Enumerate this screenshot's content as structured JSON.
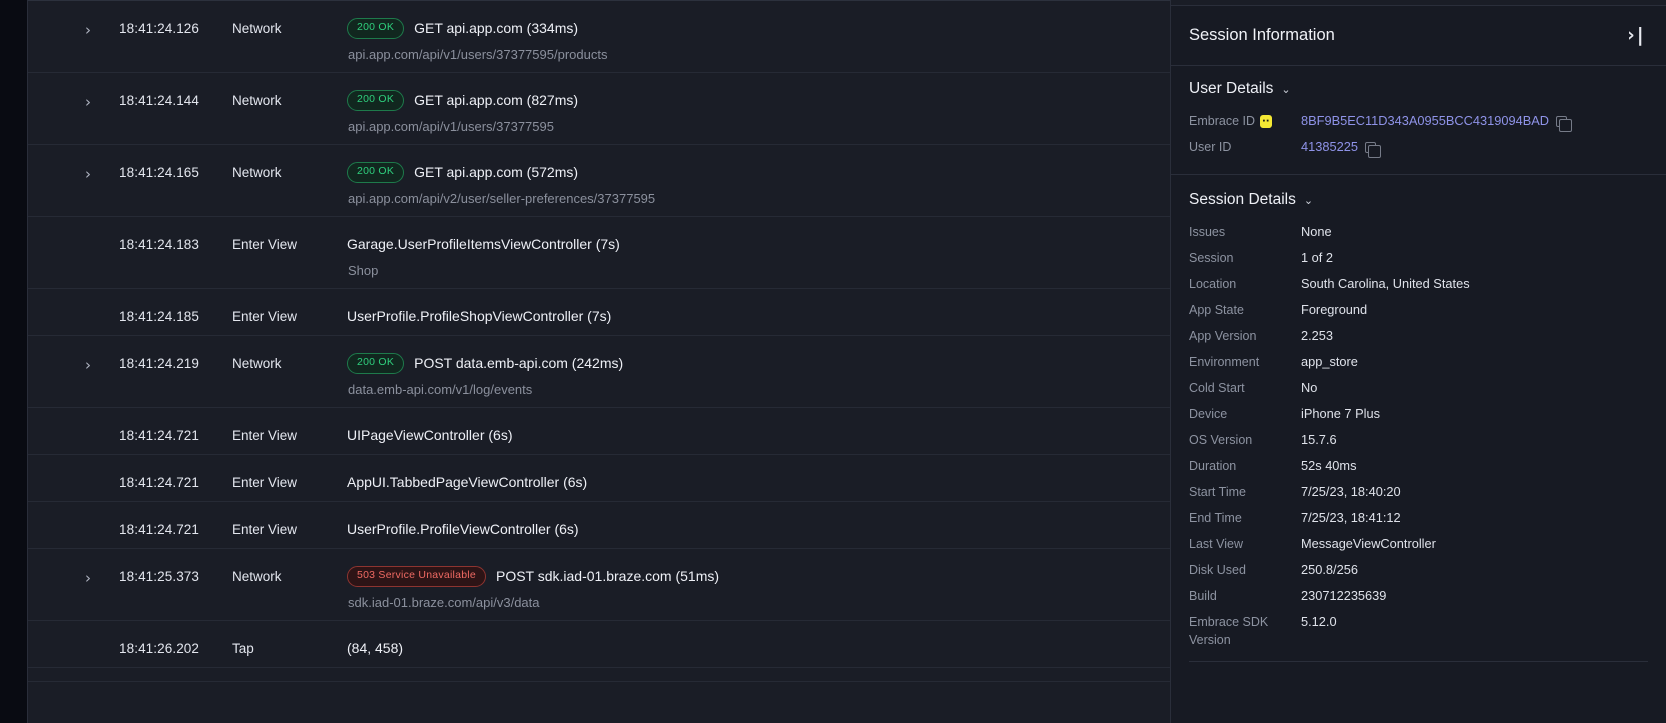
{
  "timeline": {
    "rows": [
      {
        "caret": "›",
        "has_caret": true,
        "time": "18:41:24.126",
        "type": "Network",
        "badge": "200 OK",
        "badge_kind": "ok",
        "title": "GET api.app.com (334ms)",
        "sub": "api.app.com/api/v1/users/37377595/products",
        "error": false
      },
      {
        "caret": "›",
        "has_caret": true,
        "time": "18:41:24.144",
        "type": "Network",
        "badge": "200 OK",
        "badge_kind": "ok",
        "title": "GET api.app.com (827ms)",
        "sub": "api.app.com/api/v1/users/37377595",
        "error": false
      },
      {
        "caret": "›",
        "has_caret": true,
        "time": "18:41:24.165",
        "type": "Network",
        "badge": "200 OK",
        "badge_kind": "ok",
        "title": "GET api.app.com (572ms)",
        "sub": "api.app.com/api/v2/user/seller-preferences/37377595",
        "error": false
      },
      {
        "caret": "",
        "has_caret": false,
        "time": "18:41:24.183",
        "type": "Enter View",
        "badge": "",
        "badge_kind": "none",
        "title": "Garage.UserProfileItemsViewController (7s)",
        "sub": "Shop",
        "error": false
      },
      {
        "caret": "",
        "has_caret": false,
        "time": "18:41:24.185",
        "type": "Enter View",
        "badge": "",
        "badge_kind": "none",
        "title": "UserProfile.ProfileShopViewController (7s)",
        "sub": "",
        "error": false
      },
      {
        "caret": "›",
        "has_caret": true,
        "time": "18:41:24.219",
        "type": "Network",
        "badge": "200 OK",
        "badge_kind": "ok",
        "title": "POST data.emb-api.com (242ms)",
        "sub": "data.emb-api.com/v1/log/events",
        "error": false
      },
      {
        "caret": "",
        "has_caret": false,
        "time": "18:41:24.721",
        "type": "Enter View",
        "badge": "",
        "badge_kind": "none",
        "title": "UIPageViewController (6s)",
        "sub": "",
        "error": false
      },
      {
        "caret": "",
        "has_caret": false,
        "time": "18:41:24.721",
        "type": "Enter View",
        "badge": "",
        "badge_kind": "none",
        "title": "AppUI.TabbedPageViewController (6s)",
        "sub": "",
        "error": false
      },
      {
        "caret": "",
        "has_caret": false,
        "time": "18:41:24.721",
        "type": "Enter View",
        "badge": "",
        "badge_kind": "none",
        "title": "UserProfile.ProfileViewController (6s)",
        "sub": "",
        "error": false
      },
      {
        "caret": "›",
        "has_caret": true,
        "time": "18:41:25.373",
        "type": "Network",
        "badge": "503 Service Unavailable",
        "badge_kind": "err",
        "title": "POST sdk.iad-01.braze.com (51ms)",
        "sub": "sdk.iad-01.braze.com/api/v3/data",
        "error": true
      },
      {
        "caret": "",
        "has_caret": false,
        "time": "18:41:26.202",
        "type": "Tap",
        "badge": "",
        "badge_kind": "none",
        "title": "(84, 458)",
        "sub": "",
        "error": false
      }
    ]
  },
  "panel": {
    "title": "Session Information",
    "collapse_icon": "›|",
    "user_details": {
      "heading": "User Details",
      "chevron": "⌄",
      "rows": [
        {
          "key": "Embrace ID",
          "value": "8BF9B5EC11D343A0955BCC4319094BAD",
          "badge": "··",
          "copy": true,
          "link": true
        },
        {
          "key": "User ID",
          "value": "41385225",
          "badge": "",
          "copy": true,
          "link": true
        }
      ]
    },
    "session_details": {
      "heading": "Session Details",
      "chevron": "⌄",
      "rows": [
        {
          "key": "Issues",
          "value": "None"
        },
        {
          "key": "Session",
          "value": "1 of 2"
        },
        {
          "key": "Location",
          "value": "South Carolina, United States"
        },
        {
          "key": "App State",
          "value": "Foreground"
        },
        {
          "key": "App Version",
          "value": "2.253"
        },
        {
          "key": "Environment",
          "value": "app_store"
        },
        {
          "key": "Cold Start",
          "value": "No"
        },
        {
          "key": "Device",
          "value": "iPhone 7 Plus"
        },
        {
          "key": "OS Version",
          "value": "15.7.6"
        },
        {
          "key": "Duration",
          "value": "52s 40ms"
        },
        {
          "key": "Start Time",
          "value": "7/25/23, 18:40:20"
        },
        {
          "key": "End Time",
          "value": "7/25/23, 18:41:12"
        },
        {
          "key": "Last View",
          "value": "MessageViewController"
        },
        {
          "key": "Disk Used",
          "value": "250.8/256"
        },
        {
          "key": "Build",
          "value": "230712235639"
        },
        {
          "key": "Embrace SDK Version",
          "value": "5.12.0"
        }
      ]
    }
  },
  "colors": {
    "background": "#0a0c14",
    "surface": "#1a1d26",
    "panel": "#171a23",
    "border": "#2a2e3a",
    "text": "#e3e6ee",
    "muted": "#8b909d",
    "success": "#2fcf7d",
    "error": "#e02b26",
    "link": "#8f93e8",
    "highlight": "#f4e834"
  }
}
